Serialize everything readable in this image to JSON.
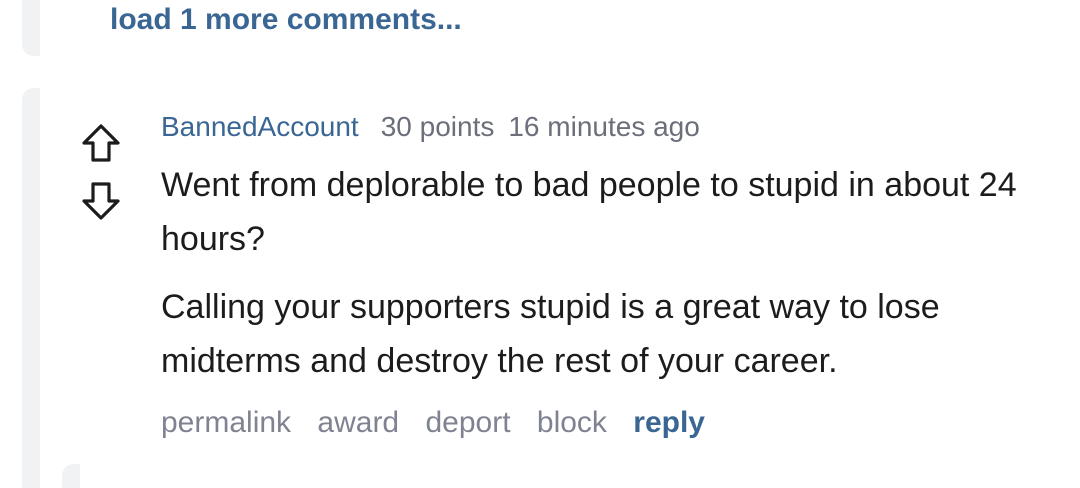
{
  "thread": {
    "load_more_label": "load 1 more comments..."
  },
  "comment": {
    "author": "BannedAccount",
    "points": "30 points",
    "time": "16 minutes ago",
    "paragraphs": [
      "Went from deplorable to bad people to stupid in about 24 hours?",
      "Calling your supporters stupid is a great way to lose midterms and destroy the rest of your career."
    ],
    "actions": {
      "permalink": "permalink",
      "award": "award",
      "deport": "deport",
      "block": "block",
      "reply": "reply"
    }
  },
  "icons": {
    "upvote": "arrow-up-outline-icon",
    "downvote": "arrow-down-outline-icon"
  },
  "colors": {
    "link_blue": "#3a6694",
    "meta_gray": "#6b6f7a",
    "action_gray": "#7f8391",
    "text": "#1c1c1c",
    "thread_line": "#f1f2f4"
  }
}
